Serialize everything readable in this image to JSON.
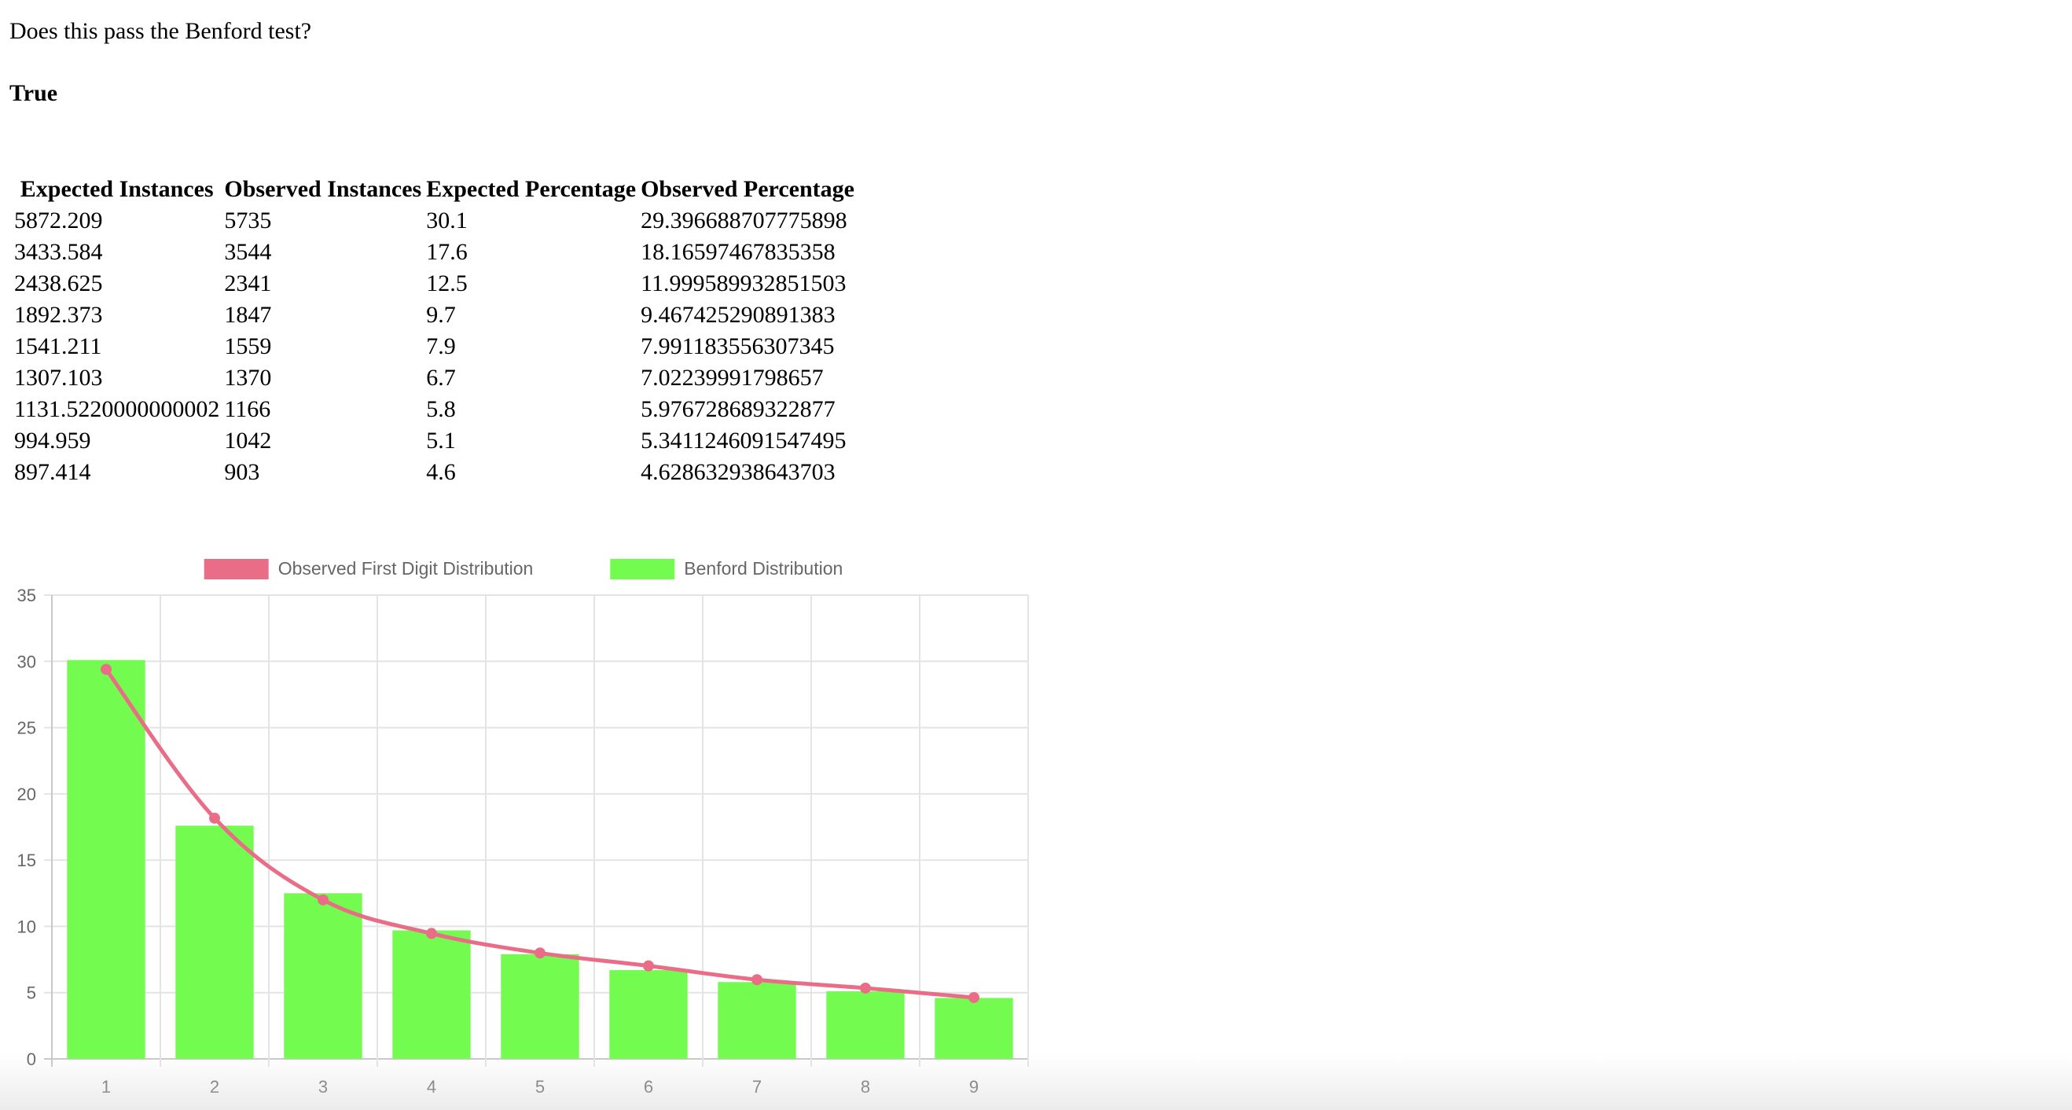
{
  "question": "Does this pass the Benford test?",
  "answer": "True",
  "table": {
    "headers": [
      "Expected Instances",
      "Observed Instances",
      "Expected Percentage",
      "Observed Percentage"
    ],
    "rows": [
      [
        "5872.209",
        "5735",
        "30.1",
        "29.396688707775898"
      ],
      [
        "3433.584",
        "3544",
        "17.6",
        "18.16597467835358"
      ],
      [
        "2438.625",
        "2341",
        "12.5",
        "11.999589932851503"
      ],
      [
        "1892.373",
        "1847",
        "9.7",
        "9.467425290891383"
      ],
      [
        "1541.211",
        "1559",
        "7.9",
        "7.991183556307345"
      ],
      [
        "1307.103",
        "1370",
        "6.7",
        "7.02239991798657"
      ],
      [
        "1131.5220000000002",
        "1166",
        "5.8",
        "5.976728689322877"
      ],
      [
        "994.959",
        "1042",
        "5.1",
        "5.3411246091547495"
      ],
      [
        "897.414",
        "903",
        "4.6",
        "4.628632938643703"
      ]
    ]
  },
  "chart_data": {
    "type": "bar",
    "categories": [
      "1",
      "2",
      "3",
      "4",
      "5",
      "6",
      "7",
      "8",
      "9"
    ],
    "series": [
      {
        "name": "Observed First Digit Distribution",
        "type": "line",
        "color": "#ea6d87",
        "values": [
          29.396688707775898,
          18.16597467835358,
          11.999589932851503,
          9.467425290891383,
          7.991183556307345,
          7.02239991798657,
          5.976728689322877,
          5.3411246091547495,
          4.628632938643703
        ]
      },
      {
        "name": "Benford Distribution",
        "type": "bar",
        "color": "#74fb4f",
        "values": [
          30.1,
          17.6,
          12.5,
          9.7,
          7.9,
          6.7,
          5.8,
          5.1,
          4.6
        ]
      }
    ],
    "ylim": [
      0,
      35
    ],
    "yticks": [
      "0",
      "5",
      "10",
      "15",
      "20",
      "25",
      "30",
      "35"
    ],
    "grid": true,
    "legend_position": "top"
  }
}
